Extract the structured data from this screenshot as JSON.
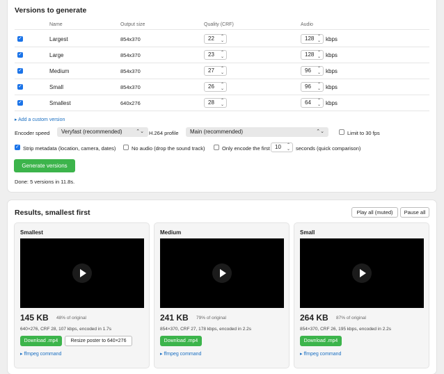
{
  "versions": {
    "title": "Versions to generate",
    "columns": [
      "Name",
      "Output size",
      "Quality (CRF)",
      "Audio"
    ],
    "audio_unit": "kbps",
    "rows": [
      {
        "name": "Largest",
        "size": "854x370",
        "crf": "22",
        "audio": "128"
      },
      {
        "name": "Large",
        "size": "854x370",
        "crf": "23",
        "audio": "128"
      },
      {
        "name": "Medium",
        "size": "854x370",
        "crf": "27",
        "audio": "96"
      },
      {
        "name": "Small",
        "size": "854x370",
        "crf": "26",
        "audio": "96"
      },
      {
        "name": "Smallest",
        "size": "640x276",
        "crf": "28",
        "audio": "64"
      }
    ],
    "add_custom": "Add a custom version",
    "encoder_speed_label": "Encoder speed",
    "encoder_speed_value": "Veryfast (recommended)",
    "h264_label": "H.264 profile",
    "h264_value": "Main (recommended)",
    "limit_fps": "Limit to 30 fps",
    "strip_metadata": "Strip metadata (location, camera, dates)",
    "no_audio": "No audio (drop the sound track)",
    "only_encode_label": "Only encode the first",
    "only_encode_value": "10",
    "only_encode_suffix": "seconds (quick comparison)",
    "generate_button": "Generate versions",
    "status": "Done: 5 versions in 11.8s."
  },
  "results": {
    "title": "Results, smallest first",
    "play_all": "Play all (muted)",
    "pause_all": "Pause all",
    "items": [
      {
        "title": "Smallest",
        "size": "145 KB",
        "pct": "48% of original",
        "meta": "640×276, CRF 28, 107 kbps, encoded in 1.7s",
        "download": "Download .mp4",
        "resize": "Resize poster to 640×276",
        "ffmpeg": "ffmpeg command"
      },
      {
        "title": "Medium",
        "size": "241 KB",
        "pct": "79% of original",
        "meta": "854×370, CRF 27, 178 kbps, encoded in 2.2s",
        "download": "Download .mp4",
        "ffmpeg": "ffmpeg command"
      },
      {
        "title": "Small",
        "size": "264 KB",
        "pct": "87% of original",
        "meta": "854×370, CRF 26, 195 kbps, encoded in 2.2s",
        "download": "Download .mp4",
        "ffmpeg": "ffmpeg command"
      }
    ]
  },
  "icons": {
    "checkbox_checked": "✓",
    "spinner": "⌃⌄",
    "chevron": "⌃⌄",
    "triangle": "▸"
  },
  "colors": {
    "accent_green": "#3cb44b",
    "checkbox_blue": "#1a73e8",
    "link_blue": "#1a6fc2"
  }
}
